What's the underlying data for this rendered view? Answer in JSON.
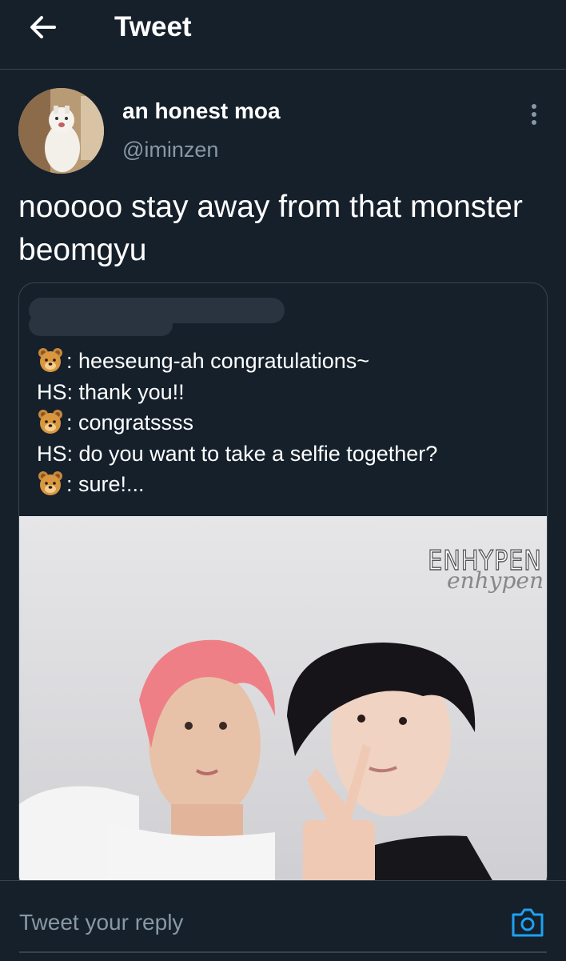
{
  "header": {
    "title": "Tweet",
    "back_icon": "arrow-left-icon"
  },
  "tweet": {
    "author_name": "an honest moa",
    "author_handle": "@iminzen",
    "text": "nooooo stay away from that monster beomgyu",
    "more_icon": "more-vertical-icon"
  },
  "quoted": {
    "lines": [
      {
        "speaker_icon": "bear-emoji",
        "text": ": heeseung-ah congratulations~"
      },
      {
        "speaker": "HS",
        "text": ": thank you!!"
      },
      {
        "speaker_icon": "bear-emoji",
        "text": ": congratssss"
      },
      {
        "speaker": "HS",
        "text": ": do you want to take a selfie together?"
      },
      {
        "speaker_icon": "bear-emoji",
        "text": ": sure!..."
      }
    ],
    "photo_caption": "ENHYPEN",
    "photo_script": "enhypen"
  },
  "reply": {
    "placeholder": "Tweet your reply",
    "camera_icon": "camera-icon"
  },
  "colors": {
    "background": "#15202b",
    "border": "#38444d",
    "secondary_text": "#8899a6",
    "accent": "#1da1f2"
  }
}
